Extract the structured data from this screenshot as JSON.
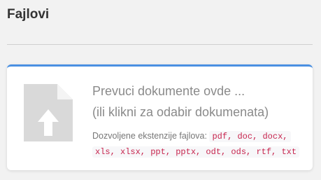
{
  "section": {
    "title": "Fajlovi"
  },
  "dropzone": {
    "title": "Prevuci dokumente ovde ...",
    "subtitle": "(ili klikni za odabir dokumenata)",
    "allowed_label": "Dozvoljene ekstenzije fajlova:",
    "allowed_extensions": "pdf, doc, docx, xls, xlsx, ppt, pptx, odt, ods, rtf, txt",
    "icon": "file-upload-icon"
  },
  "colors": {
    "accent": "#4a90e2",
    "extension_text": "#c7254e",
    "icon_gray": "#d9d9d9"
  }
}
